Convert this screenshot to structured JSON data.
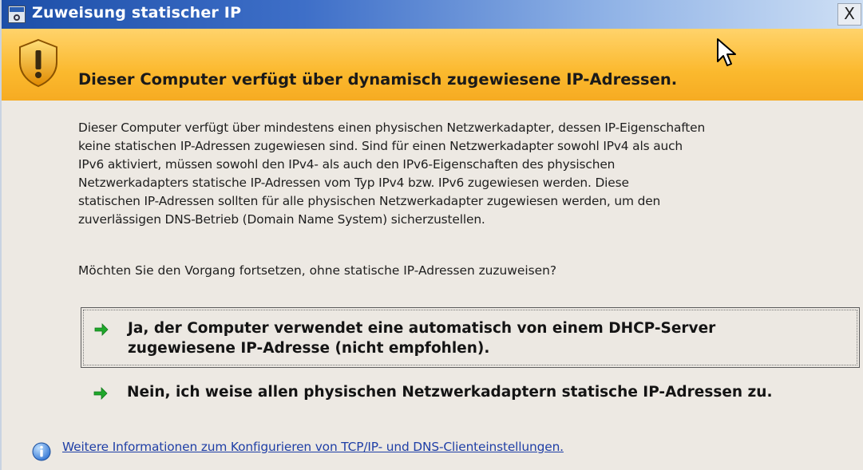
{
  "window": {
    "title": "Zuweisung statischer IP",
    "close_label": "X"
  },
  "banner": {
    "text": "Dieser Computer verfügt über dynamisch zugewiesene IP-Adressen.",
    "icon": "warning-shield-icon"
  },
  "body": {
    "lines": [
      "Dieser Computer verfügt über mindestens einen physischen Netzwerkadapter, dessen IP-Eigenschaften",
      "keine statischen IP-Adressen zugewiesen sind. Sind für einen Netzwerkadapter sowohl IPv4 als auch",
      "IPv6 aktiviert, müssen sowohl den IPv4- als auch den IPv6-Eigenschaften des physischen",
      "Netzwerkadapters statische IP-Adressen vom Typ IPv4 bzw. IPv6 zugewiesen werden. Diese",
      "statischen IP-Adressen sollten für alle physischen Netzwerkadapter zugewiesen werden, um den",
      "zuverlässigen DNS-Betrieb (Domain Name System) sicherzustellen."
    ],
    "question": "Möchten Sie den Vorgang fortsetzen, ohne statische IP-Adressen zuzuweisen?"
  },
  "options": [
    {
      "lines": [
        "Ja, der Computer verwendet eine automatisch von einem DHCP-Server",
        "zugewiesene IP-Adresse (nicht empfohlen)."
      ],
      "selected": true,
      "icon": "green-arrow-icon"
    },
    {
      "lines": [
        "Nein, ich weise allen physischen Netzwerkadaptern statische IP-Adressen zu."
      ],
      "selected": false,
      "icon": "green-arrow-icon"
    }
  ],
  "footer": {
    "link_text": "Weitere Informationen zum Konfigurieren von TCP/IP- und DNS-Clienteinstellungen.",
    "icon": "info-icon"
  },
  "colors": {
    "titlebar": "#1d4fa8",
    "banner": "#fbb92e",
    "dialog_background": "#ede9e3",
    "arrow_green": "#1fa82b",
    "link": "#1f3fa6"
  }
}
